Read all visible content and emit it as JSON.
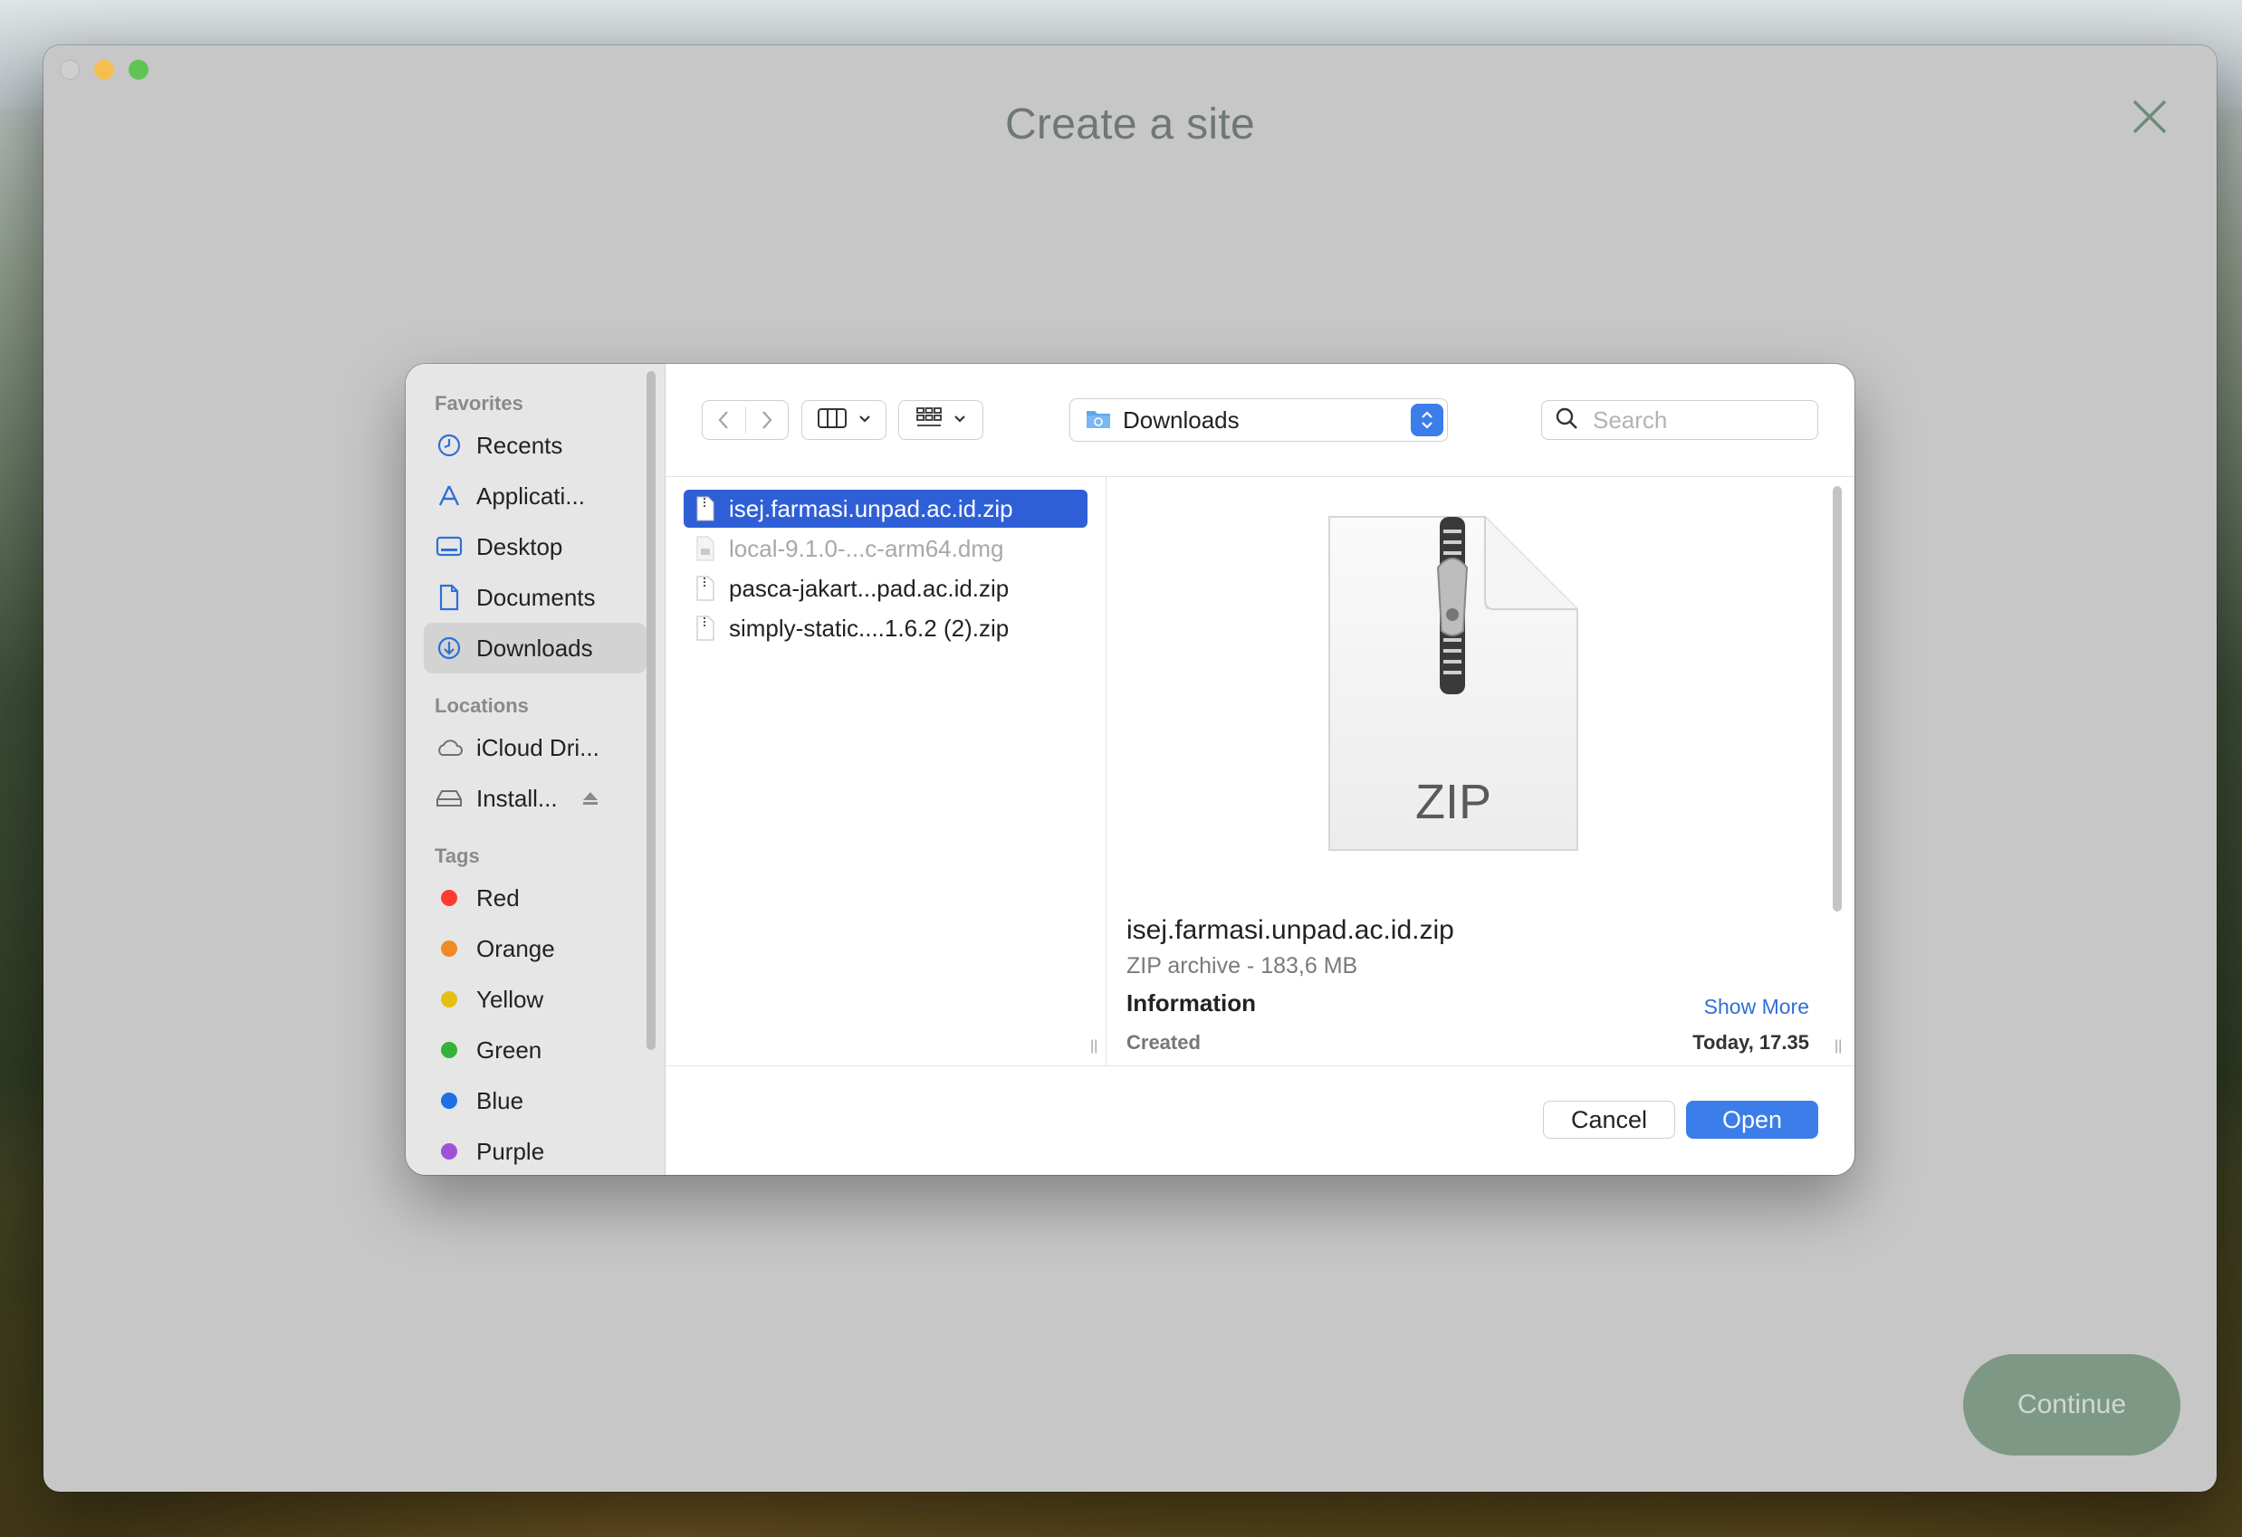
{
  "app": {
    "title": "Create a site",
    "continue_label": "Continue"
  },
  "dialog": {
    "sidebar": {
      "favorites_label": "Favorites",
      "favorites": [
        {
          "label": "Recents",
          "icon": "clock-icon"
        },
        {
          "label": "Applicati...",
          "icon": "applications-icon"
        },
        {
          "label": "Desktop",
          "icon": "desktop-icon"
        },
        {
          "label": "Documents",
          "icon": "document-icon"
        },
        {
          "label": "Downloads",
          "icon": "download-icon"
        }
      ],
      "locations_label": "Locations",
      "locations": [
        {
          "label": "iCloud Dri...",
          "icon": "cloud-icon"
        },
        {
          "label": "Install...",
          "icon": "disk-icon"
        }
      ],
      "tags_label": "Tags",
      "tags": [
        {
          "label": "Red",
          "color": "#ff3b30"
        },
        {
          "label": "Orange",
          "color": "#f08a24"
        },
        {
          "label": "Yellow",
          "color": "#e6be14"
        },
        {
          "label": "Green",
          "color": "#33b339"
        },
        {
          "label": "Blue",
          "color": "#1f6fe6"
        },
        {
          "label": "Purple",
          "color": "#a052d6"
        }
      ]
    },
    "toolbar": {
      "location": "Downloads",
      "search_placeholder": "Search"
    },
    "files": [
      {
        "name": "isej.farmasi.unpad.ac.id.zip"
      },
      {
        "name": "local-9.1.0-...c-arm64.dmg"
      },
      {
        "name": "pasca-jakart...pad.ac.id.zip"
      },
      {
        "name": "simply-static....1.6.2 (2).zip"
      }
    ],
    "preview": {
      "icon_label": "ZIP",
      "name": "isej.farmasi.unpad.ac.id.zip",
      "kind": "ZIP archive - 183,6 MB",
      "info_label": "Information",
      "show_more": "Show More",
      "created_label": "Created",
      "created_value": "Today, 17.35"
    },
    "buttons": {
      "cancel": "Cancel",
      "open": "Open"
    }
  }
}
